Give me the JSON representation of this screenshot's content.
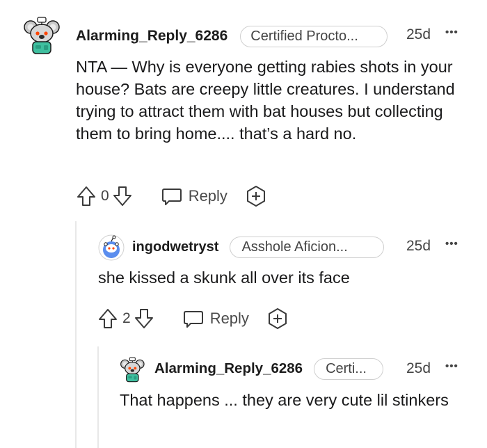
{
  "comments": [
    {
      "username": "Alarming_Reply_6286",
      "flair": "Certified Procto...",
      "age": "25d",
      "more": "•••",
      "body": "NTA — Why is everyone getting rabies shots in your house? Bats are creepy little creatures. I understand trying to attract them with bat houses but collecting them to bring home.... that’s a hard no.",
      "votes": "0",
      "reply_label": "Reply",
      "avatar": "snoo-koala-avatar"
    },
    {
      "username": "ingodwetryst",
      "flair": "Asshole Aficion...",
      "age": "25d",
      "more": "•••",
      "body": "she kissed a skunk all over its face",
      "votes": "2",
      "reply_label": "Reply",
      "avatar": "snoo-default-avatar"
    },
    {
      "username": "Alarming_Reply_6286",
      "flair": "Certi...",
      "age": "25d",
      "more": "•••",
      "body": "That happens ... they are very cute lil stinkers",
      "avatar": "snoo-koala-avatar"
    }
  ],
  "colors": {
    "text": "#1a1a1b",
    "muted": "#444444",
    "thread_line": "#e8e8e8",
    "avatar_teal": "#3fbf9f",
    "avatar_blue": "#5a8dee"
  }
}
